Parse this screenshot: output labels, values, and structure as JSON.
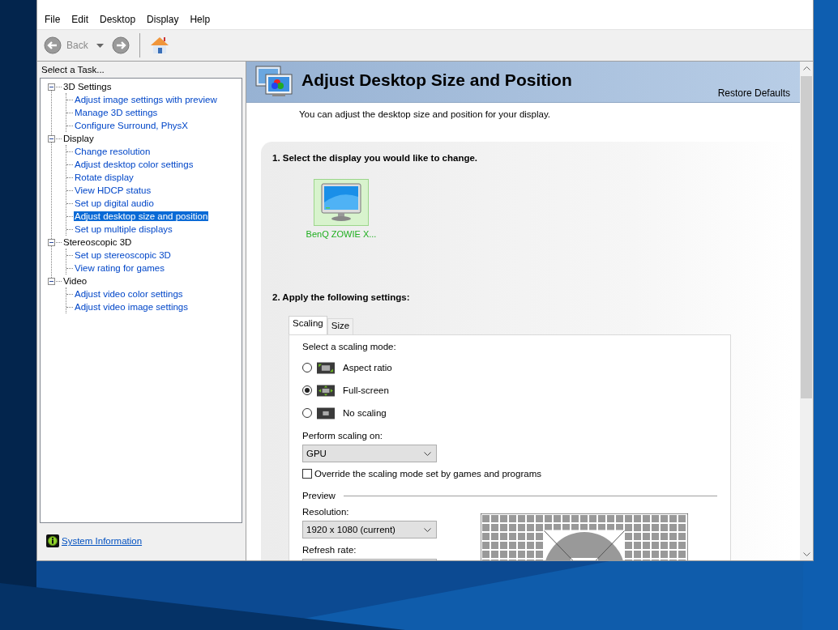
{
  "menu": [
    "File",
    "Edit",
    "Desktop",
    "Display",
    "Help"
  ],
  "toolbar": {
    "back": {
      "label": "Back",
      "disabled": true
    },
    "forward": {
      "disabled": true
    }
  },
  "task_panel": {
    "title": "Select a Task...",
    "tree": [
      {
        "label": "3D Settings",
        "expanded": true,
        "children": [
          {
            "label": "Adjust image settings with preview",
            "selected": false
          },
          {
            "label": "Manage 3D settings",
            "selected": false
          },
          {
            "label": "Configure Surround, PhysX",
            "selected": false
          }
        ]
      },
      {
        "label": "Display",
        "expanded": true,
        "children": [
          {
            "label": "Change resolution",
            "selected": false
          },
          {
            "label": "Adjust desktop color settings",
            "selected": false
          },
          {
            "label": "Rotate display",
            "selected": false
          },
          {
            "label": "View HDCP status",
            "selected": false
          },
          {
            "label": "Set up digital audio",
            "selected": false
          },
          {
            "label": "Adjust desktop size and position",
            "selected": true
          },
          {
            "label": "Set up multiple displays",
            "selected": false
          }
        ]
      },
      {
        "label": "Stereoscopic 3D",
        "expanded": true,
        "children": [
          {
            "label": "Set up stereoscopic 3D",
            "selected": false
          },
          {
            "label": "View rating for games",
            "selected": false
          }
        ]
      },
      {
        "label": "Video",
        "expanded": true,
        "children": [
          {
            "label": "Adjust video color settings",
            "selected": false
          },
          {
            "label": "Adjust video image settings",
            "selected": false
          }
        ]
      }
    ],
    "footer_link": "System Information"
  },
  "page": {
    "title": "Adjust Desktop Size and Position",
    "restore": "Restore Defaults",
    "description": "You can adjust the desktop size and position for your display.",
    "step1": "1. Select the display you would like to change.",
    "displays": [
      {
        "label": "BenQ ZOWIE X...",
        "selected": true
      }
    ],
    "step2": "2. Apply the following settings:",
    "tabs": [
      {
        "label": "Scaling",
        "selected": true
      },
      {
        "label": "Size",
        "selected": false
      }
    ],
    "scaling_prompt": "Select a scaling mode:",
    "modes": [
      {
        "label": "Aspect ratio",
        "kind": "aspect",
        "selected": false
      },
      {
        "label": "Full-screen",
        "kind": "fullscreen",
        "selected": true
      },
      {
        "label": "No scaling",
        "kind": "none",
        "selected": false
      }
    ],
    "perform_label": "Perform scaling on:",
    "perform_value": "GPU",
    "override": {
      "label": "Override the scaling mode set by games and programs",
      "checked": false
    },
    "preview_label": "Preview",
    "resolution_label": "Resolution:",
    "resolution_value": "1920 x 1080 (current)",
    "refresh_label": "Refresh rate:"
  }
}
